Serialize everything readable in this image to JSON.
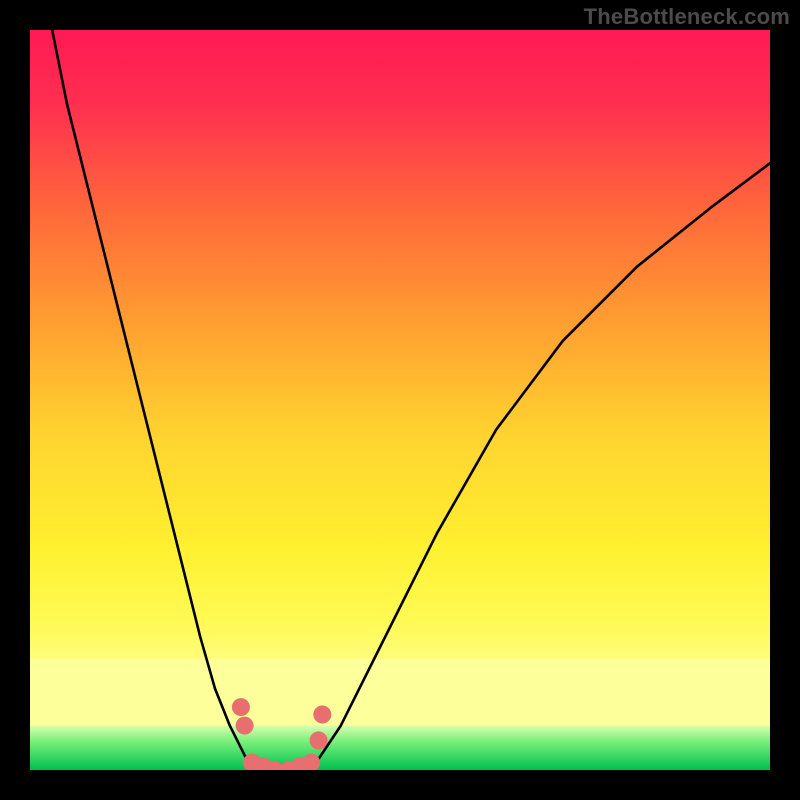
{
  "watermark": "TheBottleneck.com",
  "colors": {
    "frame": "#000000",
    "curve": "#000000",
    "markers": "#e76f6f",
    "green_band_top": "#7af07a",
    "green_band_bottom": "#00c050",
    "gradient_stops": [
      {
        "offset": 0.0,
        "color": "#ff1a55"
      },
      {
        "offset": 0.1,
        "color": "#ff2f50"
      },
      {
        "offset": 0.25,
        "color": "#ff6a3a"
      },
      {
        "offset": 0.4,
        "color": "#ffa030"
      },
      {
        "offset": 0.55,
        "color": "#ffd430"
      },
      {
        "offset": 0.7,
        "color": "#fff030"
      },
      {
        "offset": 0.8,
        "color": "#fffa55"
      },
      {
        "offset": 0.88,
        "color": "#fdff90"
      }
    ]
  },
  "chart_data": {
    "type": "line",
    "title": "",
    "xlabel": "",
    "ylabel": "",
    "xlim": [
      0,
      100
    ],
    "ylim": [
      0,
      100
    ],
    "grid": false,
    "legend": false,
    "series": [
      {
        "name": "curve-left",
        "x": [
          3,
          5,
          8,
          12,
          16,
          20,
          23,
          25,
          27,
          28.5,
          30
        ],
        "y": [
          100,
          90,
          78,
          62,
          46,
          30,
          18,
          11,
          6,
          3,
          0
        ]
      },
      {
        "name": "curve-valley",
        "x": [
          30,
          32,
          34,
          36,
          38
        ],
        "y": [
          0,
          0,
          0,
          0,
          0
        ]
      },
      {
        "name": "curve-right",
        "x": [
          38,
          42,
          48,
          55,
          63,
          72,
          82,
          92,
          100
        ],
        "y": [
          0,
          6,
          18,
          32,
          46,
          58,
          68,
          76,
          82
        ]
      }
    ],
    "markers": {
      "name": "highlight-points",
      "color": "#e76f6f",
      "radius": 9,
      "points": [
        {
          "x": 28.5,
          "y": 8.5
        },
        {
          "x": 29.0,
          "y": 6.0
        },
        {
          "x": 30.0,
          "y": 1.0
        },
        {
          "x": 31.5,
          "y": 0.5
        },
        {
          "x": 33.0,
          "y": 0.0
        },
        {
          "x": 35.0,
          "y": 0.0
        },
        {
          "x": 36.5,
          "y": 0.5
        },
        {
          "x": 38.0,
          "y": 1.0
        },
        {
          "x": 39.0,
          "y": 4.0
        },
        {
          "x": 39.5,
          "y": 7.5
        }
      ]
    },
    "bands": {
      "pale_yellow_top": 85,
      "green_top": 94
    }
  }
}
